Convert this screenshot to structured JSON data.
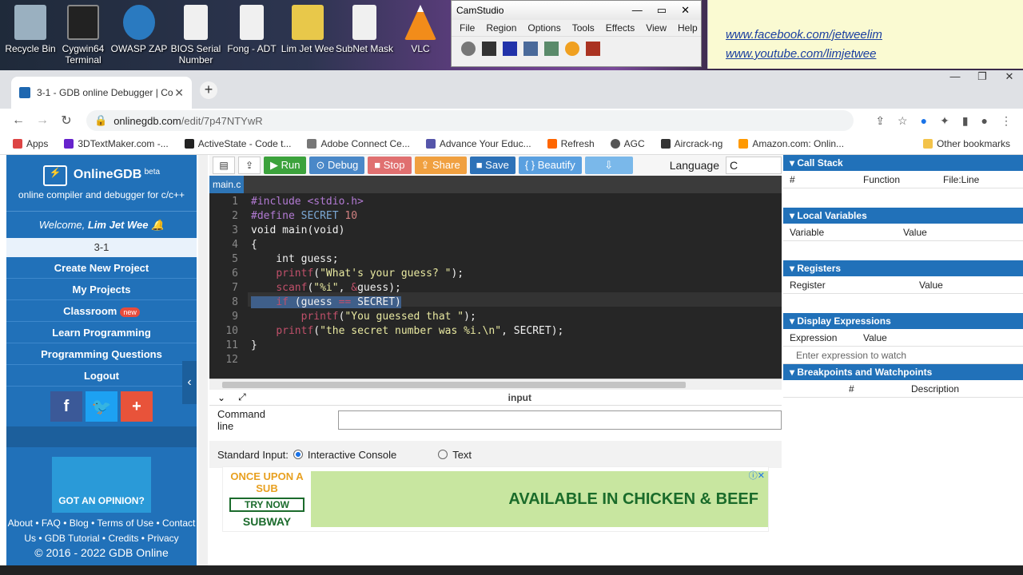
{
  "desktop": {
    "icons": [
      {
        "label": "Recycle Bin",
        "color": "#8ab"
      },
      {
        "label": "Cygwin64 Terminal",
        "color": "#222"
      },
      {
        "label": "OWASP ZAP",
        "color": "#2a7ac0"
      },
      {
        "label": "BIOS Serial Number",
        "color": "#f2f2f2"
      },
      {
        "label": "Fong - ADT",
        "color": "#f2f2f2"
      },
      {
        "label": "Lim Jet Wee",
        "color": "#e8c84a"
      },
      {
        "label": "SubNet Mask",
        "color": "#f2f2f2"
      },
      {
        "label": "VLC",
        "color": "#f28c1a"
      }
    ]
  },
  "notes": {
    "links": [
      "www.facebook.com/jetweelim",
      "www.youtube.com/limjetwee"
    ]
  },
  "camstudio": {
    "title": "CamStudio",
    "menu": [
      "File",
      "Region",
      "Options",
      "Tools",
      "Effects",
      "View",
      "Help"
    ]
  },
  "browser": {
    "tab_title": "3-1 - GDB online Debugger | Co",
    "url_host": "onlinegdb.com",
    "url_path": "/edit/7p47NTYwR",
    "bookmarks": [
      "Apps",
      "3DTextMaker.com -...",
      "ActiveState - Code t...",
      "Adobe Connect Ce...",
      "Advance Your Educ...",
      "Refresh",
      "AGC",
      "Aircrack-ng",
      "Amazon.com: Onlin..."
    ],
    "other_bookmarks": "Other bookmarks"
  },
  "sidebar": {
    "brand": "OnlineGDB",
    "beta": "beta",
    "subtitle": "online compiler and debugger for c/c++",
    "welcome": "Welcome, ",
    "user": "Lim Jet Wee",
    "project": "3-1",
    "items": [
      "Create New Project",
      "My Projects",
      "Classroom",
      "Learn Programming",
      "Programming Questions",
      "Logout"
    ],
    "new_badge": "new",
    "ad_text": "GOT AN OPINION?",
    "footer1": "About • FAQ • Blog • Terms of Use • Contact",
    "footer2": "Us • GDB Tutorial • Credits • Privacy",
    "copyright": "© 2016 - 2022 GDB Online"
  },
  "toolbar": {
    "run": "▶ Run",
    "debug": "⊙ Debug",
    "stop": "■ Stop",
    "share": "⇪ Share",
    "save": "■ Save",
    "beautify": "{ } Beautify",
    "download": "⇩",
    "language_label": "Language",
    "language": "C"
  },
  "editor": {
    "file": "main.c",
    "lines": [
      "1",
      "2",
      "3",
      "4",
      "5",
      "6",
      "7",
      "8",
      "9",
      "10",
      "11",
      "12"
    ]
  },
  "io": {
    "label": "input",
    "cmdline": "Command line",
    "stdin_label": "Standard Input:",
    "interactive": "Interactive Console",
    "text": "Text"
  },
  "ad": {
    "brand": "ONCE UPON A SUB",
    "cta": "TRY NOW",
    "brand2": "SUBWAY",
    "message": "AVAILABLE IN CHICKEN & BEEF"
  },
  "right": {
    "callstack": "Call Stack",
    "cs_cols": [
      "#",
      "Function",
      "File:Line"
    ],
    "locals": "Local Variables",
    "lv_cols": [
      "Variable",
      "Value"
    ],
    "registers": "Registers",
    "rg_cols": [
      "Register",
      "Value"
    ],
    "display": "Display Expressions",
    "de_cols": [
      "Expression",
      "Value"
    ],
    "de_placeholder": "Enter expression to watch",
    "breakpoints": "Breakpoints and Watchpoints",
    "bp_cols": [
      "#",
      "Description"
    ]
  }
}
